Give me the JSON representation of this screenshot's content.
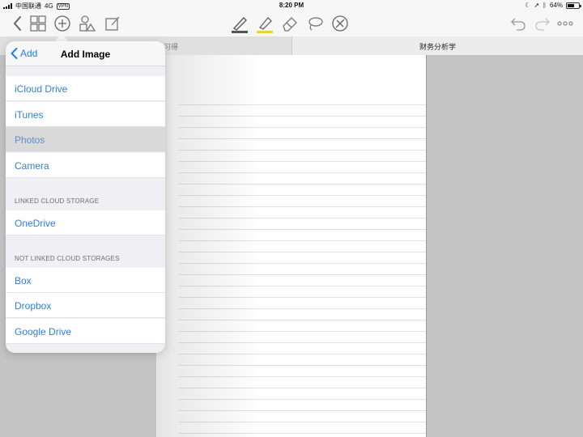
{
  "status_bar": {
    "carrier": "中国联通",
    "network": "4G",
    "vpn": "VPN",
    "time": "8:20 PM",
    "battery_text": "64%",
    "battery_level": 0.64
  },
  "toolbar": {
    "icons": [
      "back-chevron-icon",
      "grid-icon",
      "add-circle-icon",
      "shapes-icon",
      "edit-icon",
      "pen-icon",
      "highlighter-icon",
      "eraser-icon",
      "lasso-icon",
      "no-pen-icon",
      "undo-icon",
      "redo-icon",
      "more-icon"
    ],
    "pen_color": "#555555",
    "highlighter_color": "#e8d23a"
  },
  "tabs": {
    "left_label": "习得",
    "right_label": "财务分析学",
    "close_symbol": "×"
  },
  "popover": {
    "back_label": "Add",
    "title": "Add Image",
    "sources": [
      "iCloud Drive",
      "iTunes",
      "Photos",
      "Camera"
    ],
    "selected": "Photos",
    "linked_header": "LINKED CLOUD STORAGE",
    "linked": [
      "OneDrive"
    ],
    "not_linked_header": "NOT LINKED CLOUD STORAGES",
    "not_linked": [
      "Box",
      "Dropbox",
      "Google Drive"
    ]
  },
  "colors": {
    "accent": "#1f7cf7",
    "link": "#2f7fe0"
  }
}
